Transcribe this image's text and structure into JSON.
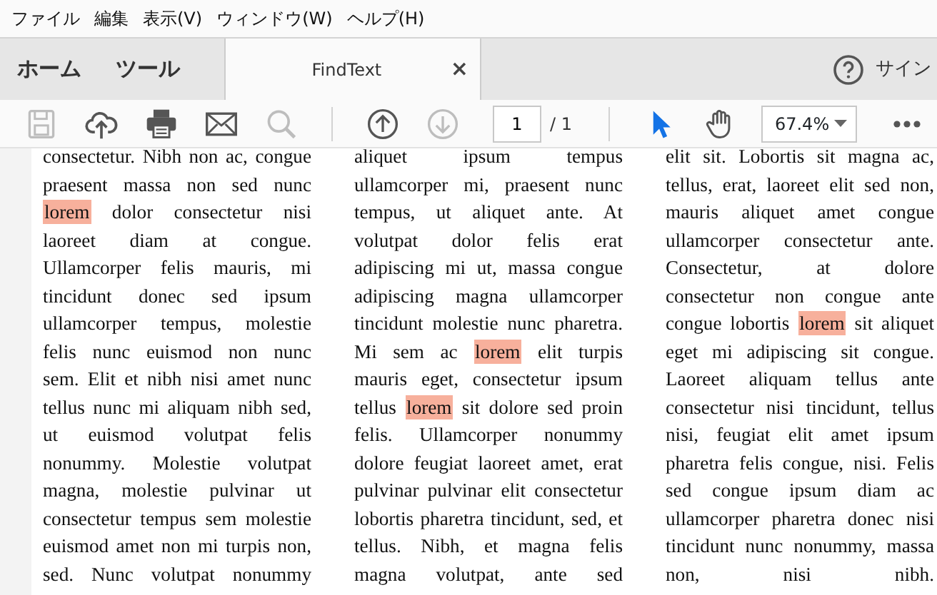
{
  "menu_bar": [
    "ファイル",
    "編集",
    "表示(V)",
    "ウィンドウ(W)",
    "ヘルプ(H)"
  ],
  "nav_tabs": [
    {
      "label": "ホーム"
    },
    {
      "label": "ツール"
    }
  ],
  "document_tab": {
    "label": "FindText",
    "close": "×"
  },
  "header_right": {
    "sign_in": "サイン"
  },
  "toolbar": [
    {
      "kind": "save",
      "disabled": true
    },
    {
      "kind": "upload",
      "disabled": false
    },
    {
      "kind": "print",
      "disabled": false
    },
    {
      "kind": "mail",
      "disabled": false
    },
    {
      "kind": "search",
      "disabled": true
    },
    {
      "kind": "divider"
    },
    {
      "kind": "prev_page",
      "disabled": false
    },
    {
      "kind": "next_page",
      "disabled": true
    }
  ],
  "page_nav": {
    "value": "1",
    "total": "/ 1"
  },
  "tools": [
    {
      "kind": "select",
      "selected": true
    },
    {
      "kind": "hand",
      "selected": false
    }
  ],
  "zoom": {
    "value": "67.4%"
  },
  "columns": [
    {
      "lines": [
        "consectetur. Nibh non ac, congue",
        "praesent massa non sed nunc",
        {
          "match": "lorem",
          "after": " dolor consectetur nisi"
        },
        "laoreet diam at congue.",
        "Ullamcorper felis mauris, mi",
        "tincidunt donec sed ipsum",
        "ullamcorper tempus, molestie",
        "felis nunc euismod non nunc",
        "sem. Elit et nibh nisi amet nunc",
        "tellus nunc mi aliquam nibh sed,",
        "ut euismod volutpat felis",
        "nonummy. Molestie volutpat",
        "magna, molestie pulvinar ut",
        "consectetur tempus sem molestie",
        "euismod amet non mi turpis non,",
        "sed. Nunc volutpat nonummy"
      ]
    },
    {
      "lines": [
        "aliquet ipsum tempus",
        "ullamcorper mi, praesent nunc",
        "tempus, ut aliquet ante. At",
        "volutpat dolor felis erat",
        "adipiscing mi ut, massa congue",
        "adipiscing magna ullamcorper",
        "tincidunt molestie nunc pharetra.",
        {
          "before": "Mi sem ac ",
          "match": "lorem",
          "after": " elit turpis"
        },
        "mauris eget, consectetur ipsum",
        {
          "before": "tellus ",
          "match": "lorem",
          "after": " sit dolore sed proin"
        },
        "felis. Ullamcorper nonummy",
        "dolore feugiat laoreet amet, erat",
        "pulvinar pulvinar elit consectetur",
        "lobortis pharetra tincidunt, sed, et",
        "tellus. Nibh, et magna felis",
        "magna volutpat, ante sed"
      ]
    },
    {
      "lines": [
        "elit sit. Lobortis sit magna ac,",
        "tellus, erat, laoreet elit sed non,",
        "mauris aliquet amet congue",
        "ullamcorper consectetur ante.",
        "Consectetur, at dolore",
        "consectetur non congue ante",
        {
          "before": "congue lobortis ",
          "match": "lorem",
          "after": " sit aliquet"
        },
        "eget mi adipiscing sit congue.",
        "Laoreet aliquam tellus ante",
        "consectetur nisi tincidunt, tellus",
        "nisi, feugiat elit amet ipsum",
        "pharetra felis congue, nisi. Felis",
        "sed congue ipsum diam ac",
        "ullamcorper pharetra donec nisi",
        "tincidunt nunc nonummy, massa",
        "non, nisi nibh."
      ]
    }
  ]
}
